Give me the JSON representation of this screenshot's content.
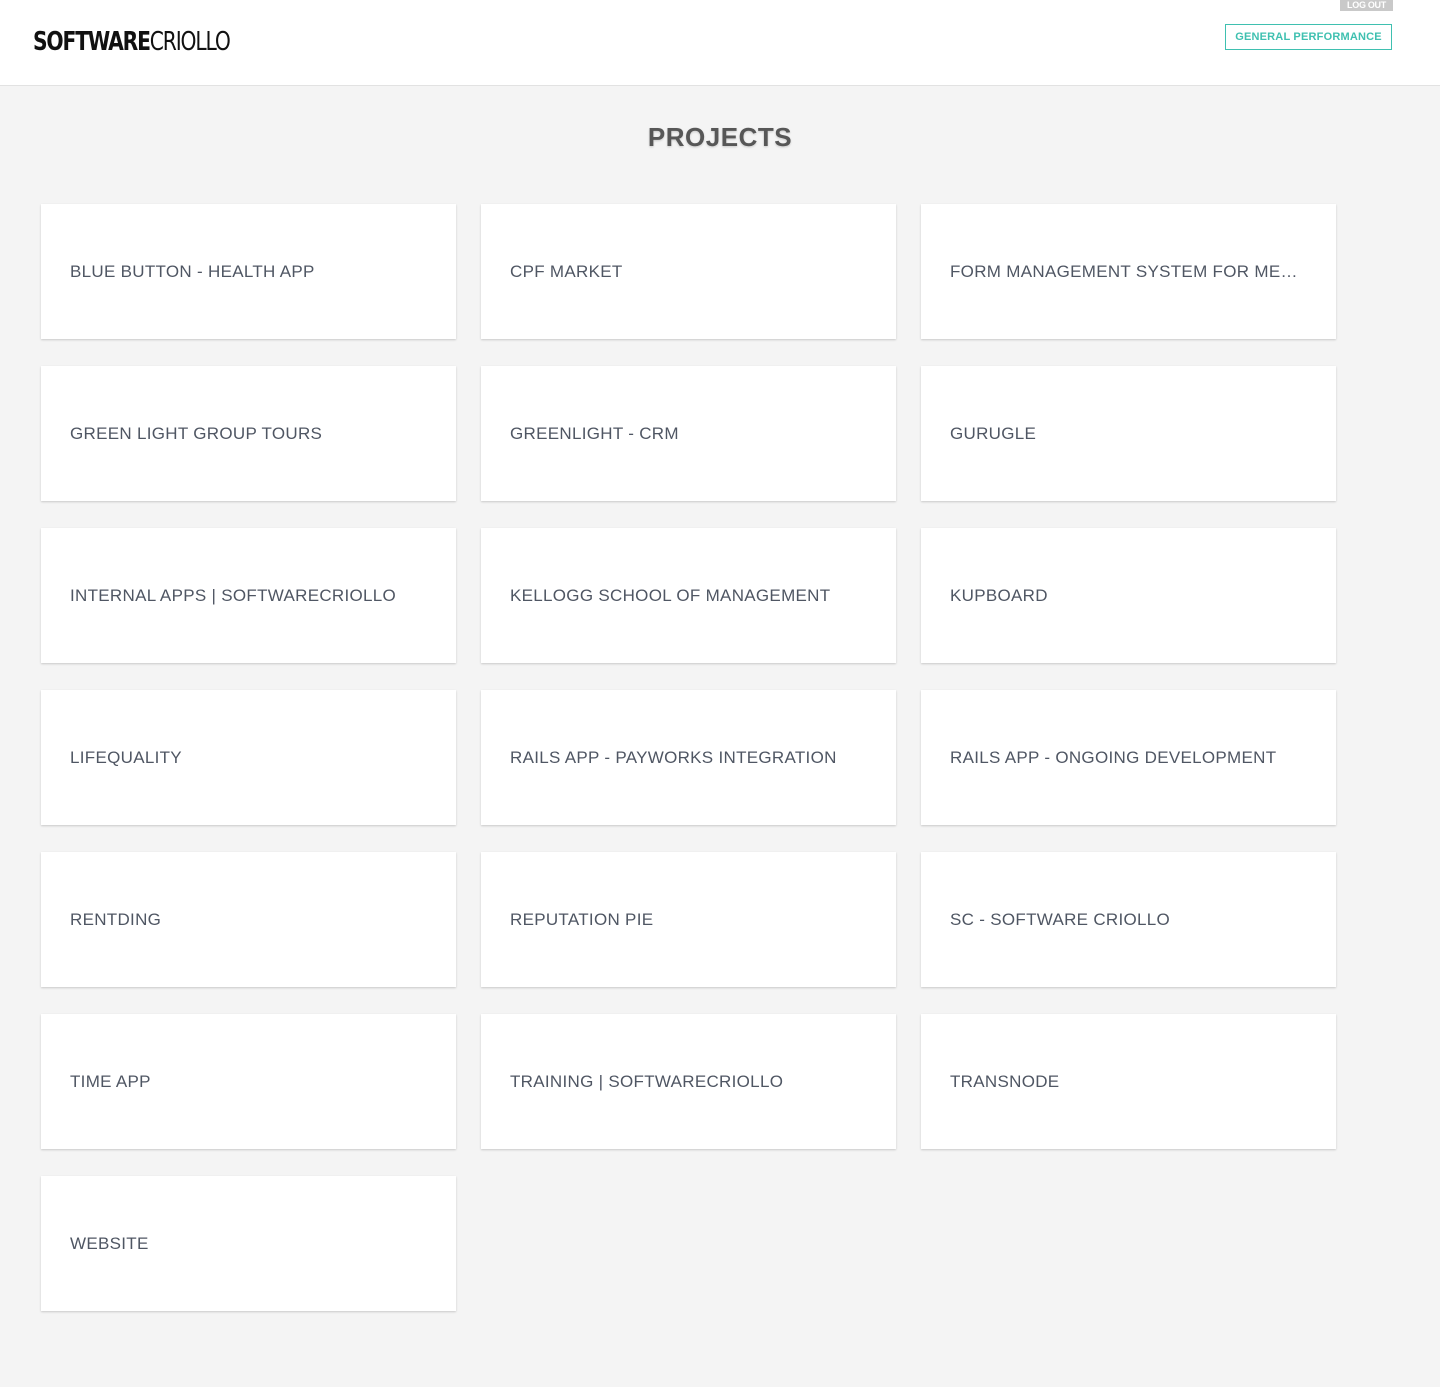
{
  "header": {
    "logo_bold": "SOFTWARE",
    "logo_light": "CRIOLLO",
    "logout_label": "LOG OUT",
    "general_performance_label": "GENERAL PERFORMANCE"
  },
  "main": {
    "title": "PROJECTS",
    "projects": [
      "BLUE BUTTON - HEALTH APP",
      "CPF MARKET",
      "FORM MANAGEMENT SYSTEM FOR MEDI...",
      "GREEN LIGHT GROUP TOURS",
      "GREENLIGHT - CRM",
      "GURUGLE",
      "INTERNAL APPS | SOFTWARECRIOLLO",
      "KELLOGG SCHOOL OF MANAGEMENT",
      "KUPBOARD",
      "LIFEQUALITY",
      "RAILS APP - PAYWORKS INTEGRATION",
      "RAILS APP - ONGOING DEVELOPMENT",
      "RENTDING",
      "REPUTATION PIE",
      "SC - SOFTWARE CRIOLLO",
      "TIME APP",
      "TRAINING | SOFTWARECRIOLLO",
      "TRANSNODE",
      "WEBSITE"
    ]
  },
  "colors": {
    "accent": "#3fc0b0",
    "background": "#f4f4f4",
    "card_text": "#4f5663"
  }
}
